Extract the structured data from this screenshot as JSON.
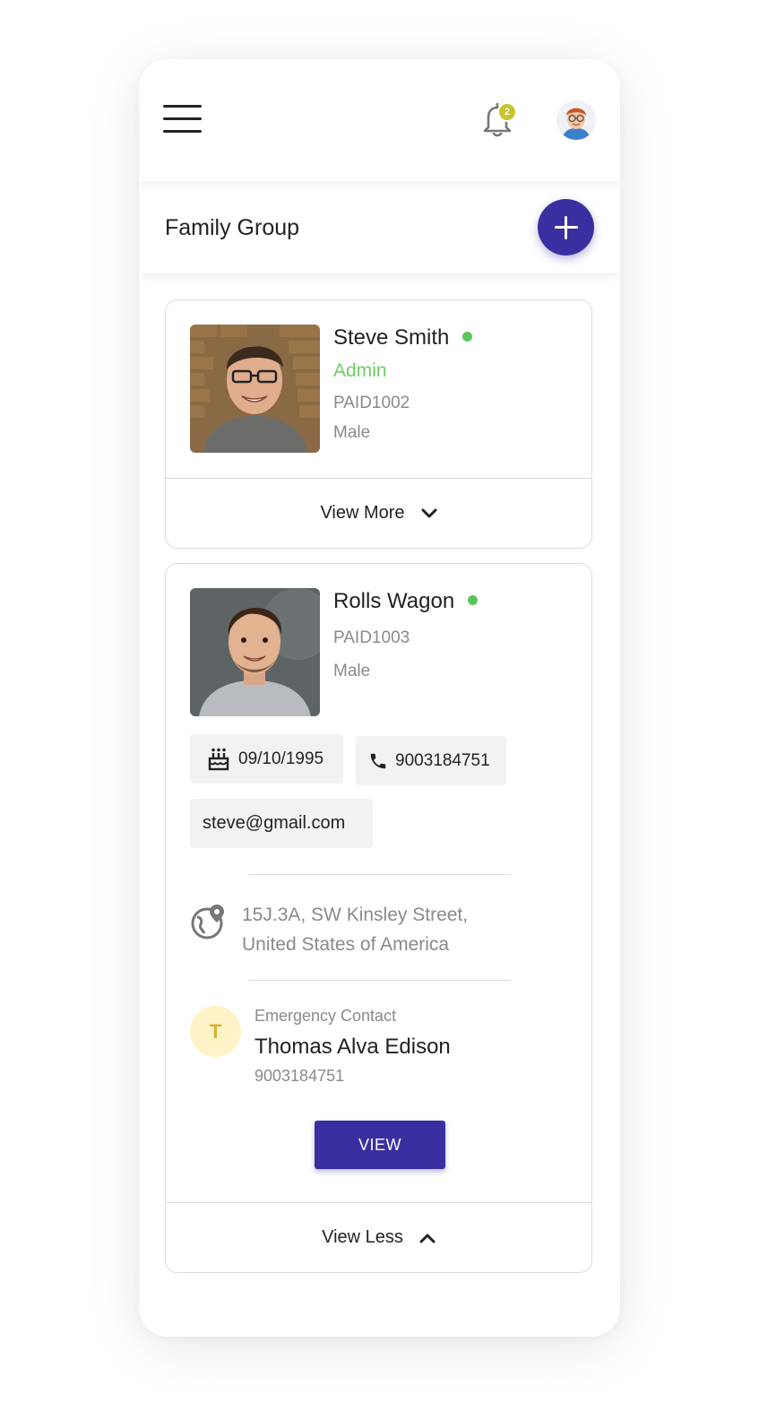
{
  "header": {
    "notification_count": "2",
    "menu_icon": "hamburger-menu-icon",
    "bell_icon": "bell-icon"
  },
  "page": {
    "title": "Family Group",
    "add_icon": "plus-icon"
  },
  "members": [
    {
      "name": "Steve Smith",
      "role": "Admin",
      "id": "PAID1002",
      "gender": "Male",
      "status_color": "#5cc559",
      "footer_label": "View More"
    },
    {
      "name": "Rolls Wagon",
      "id": "PAID1003",
      "gender": "Male",
      "status_color": "#5cc559",
      "dob": "09/10/1995",
      "phone": "9003184751",
      "email": "steve@gmail.com",
      "address_line1": "15J.3A, SW Kinsley Street,",
      "address_line2": "United States of America",
      "emergency": {
        "initial": "T",
        "label": "Emergency Contact",
        "name": "Thomas Alva Edison",
        "phone": "9003184751"
      },
      "view_button": "VIEW",
      "footer_label": "View Less"
    }
  ],
  "colors": {
    "accent": "#3a2fa0",
    "online": "#5cc559",
    "admin": "#6ccd64",
    "badge": "#c7c42d"
  }
}
